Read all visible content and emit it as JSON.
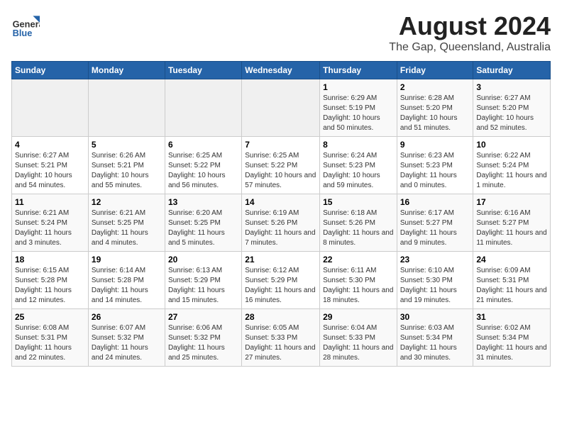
{
  "header": {
    "logo_general": "General",
    "logo_blue": "Blue",
    "title": "August 2024",
    "subtitle": "The Gap, Queensland, Australia"
  },
  "days_of_week": [
    "Sunday",
    "Monday",
    "Tuesday",
    "Wednesday",
    "Thursday",
    "Friday",
    "Saturday"
  ],
  "weeks": [
    [
      {
        "day": "",
        "empty": true
      },
      {
        "day": "",
        "empty": true
      },
      {
        "day": "",
        "empty": true
      },
      {
        "day": "",
        "empty": true
      },
      {
        "day": "1",
        "sunrise": "6:29 AM",
        "sunset": "5:19 PM",
        "daylight": "10 hours and 50 minutes."
      },
      {
        "day": "2",
        "sunrise": "6:28 AM",
        "sunset": "5:20 PM",
        "daylight": "10 hours and 51 minutes."
      },
      {
        "day": "3",
        "sunrise": "6:27 AM",
        "sunset": "5:20 PM",
        "daylight": "10 hours and 52 minutes."
      }
    ],
    [
      {
        "day": "4",
        "sunrise": "6:27 AM",
        "sunset": "5:21 PM",
        "daylight": "10 hours and 54 minutes."
      },
      {
        "day": "5",
        "sunrise": "6:26 AM",
        "sunset": "5:21 PM",
        "daylight": "10 hours and 55 minutes."
      },
      {
        "day": "6",
        "sunrise": "6:25 AM",
        "sunset": "5:22 PM",
        "daylight": "10 hours and 56 minutes."
      },
      {
        "day": "7",
        "sunrise": "6:25 AM",
        "sunset": "5:22 PM",
        "daylight": "10 hours and 57 minutes."
      },
      {
        "day": "8",
        "sunrise": "6:24 AM",
        "sunset": "5:23 PM",
        "daylight": "10 hours and 59 minutes."
      },
      {
        "day": "9",
        "sunrise": "6:23 AM",
        "sunset": "5:23 PM",
        "daylight": "11 hours and 0 minutes."
      },
      {
        "day": "10",
        "sunrise": "6:22 AM",
        "sunset": "5:24 PM",
        "daylight": "11 hours and 1 minute."
      }
    ],
    [
      {
        "day": "11",
        "sunrise": "6:21 AM",
        "sunset": "5:24 PM",
        "daylight": "11 hours and 3 minutes."
      },
      {
        "day": "12",
        "sunrise": "6:21 AM",
        "sunset": "5:25 PM",
        "daylight": "11 hours and 4 minutes."
      },
      {
        "day": "13",
        "sunrise": "6:20 AM",
        "sunset": "5:25 PM",
        "daylight": "11 hours and 5 minutes."
      },
      {
        "day": "14",
        "sunrise": "6:19 AM",
        "sunset": "5:26 PM",
        "daylight": "11 hours and 7 minutes."
      },
      {
        "day": "15",
        "sunrise": "6:18 AM",
        "sunset": "5:26 PM",
        "daylight": "11 hours and 8 minutes."
      },
      {
        "day": "16",
        "sunrise": "6:17 AM",
        "sunset": "5:27 PM",
        "daylight": "11 hours and 9 minutes."
      },
      {
        "day": "17",
        "sunrise": "6:16 AM",
        "sunset": "5:27 PM",
        "daylight": "11 hours and 11 minutes."
      }
    ],
    [
      {
        "day": "18",
        "sunrise": "6:15 AM",
        "sunset": "5:28 PM",
        "daylight": "11 hours and 12 minutes."
      },
      {
        "day": "19",
        "sunrise": "6:14 AM",
        "sunset": "5:28 PM",
        "daylight": "11 hours and 14 minutes."
      },
      {
        "day": "20",
        "sunrise": "6:13 AM",
        "sunset": "5:29 PM",
        "daylight": "11 hours and 15 minutes."
      },
      {
        "day": "21",
        "sunrise": "6:12 AM",
        "sunset": "5:29 PM",
        "daylight": "11 hours and 16 minutes."
      },
      {
        "day": "22",
        "sunrise": "6:11 AM",
        "sunset": "5:30 PM",
        "daylight": "11 hours and 18 minutes."
      },
      {
        "day": "23",
        "sunrise": "6:10 AM",
        "sunset": "5:30 PM",
        "daylight": "11 hours and 19 minutes."
      },
      {
        "day": "24",
        "sunrise": "6:09 AM",
        "sunset": "5:31 PM",
        "daylight": "11 hours and 21 minutes."
      }
    ],
    [
      {
        "day": "25",
        "sunrise": "6:08 AM",
        "sunset": "5:31 PM",
        "daylight": "11 hours and 22 minutes."
      },
      {
        "day": "26",
        "sunrise": "6:07 AM",
        "sunset": "5:32 PM",
        "daylight": "11 hours and 24 minutes."
      },
      {
        "day": "27",
        "sunrise": "6:06 AM",
        "sunset": "5:32 PM",
        "daylight": "11 hours and 25 minutes."
      },
      {
        "day": "28",
        "sunrise": "6:05 AM",
        "sunset": "5:33 PM",
        "daylight": "11 hours and 27 minutes."
      },
      {
        "day": "29",
        "sunrise": "6:04 AM",
        "sunset": "5:33 PM",
        "daylight": "11 hours and 28 minutes."
      },
      {
        "day": "30",
        "sunrise": "6:03 AM",
        "sunset": "5:34 PM",
        "daylight": "11 hours and 30 minutes."
      },
      {
        "day": "31",
        "sunrise": "6:02 AM",
        "sunset": "5:34 PM",
        "daylight": "11 hours and 31 minutes."
      }
    ]
  ]
}
